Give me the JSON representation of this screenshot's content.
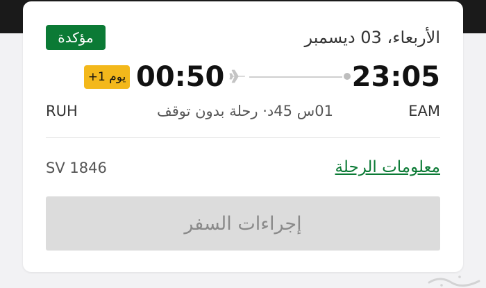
{
  "booking": {
    "status": "مؤكدة",
    "date": "الأربعاء، 03 ديسمبر",
    "departure": {
      "time": "23:05",
      "code": "EAM"
    },
    "arrival": {
      "time": "00:50",
      "code": "RUH",
      "day_offset": "+1 يوم"
    },
    "duration": "01س 45د·  رحلة بدون توقف",
    "flight_number": "SV 1846",
    "flight_info_label": "معلومات الرحلة",
    "travel_procedures_label": "إجراءات السفر"
  },
  "colors": {
    "accent_green": "#0b7a35",
    "badge_yellow": "#f3b81b",
    "button_gray": "#dcdcdc"
  }
}
